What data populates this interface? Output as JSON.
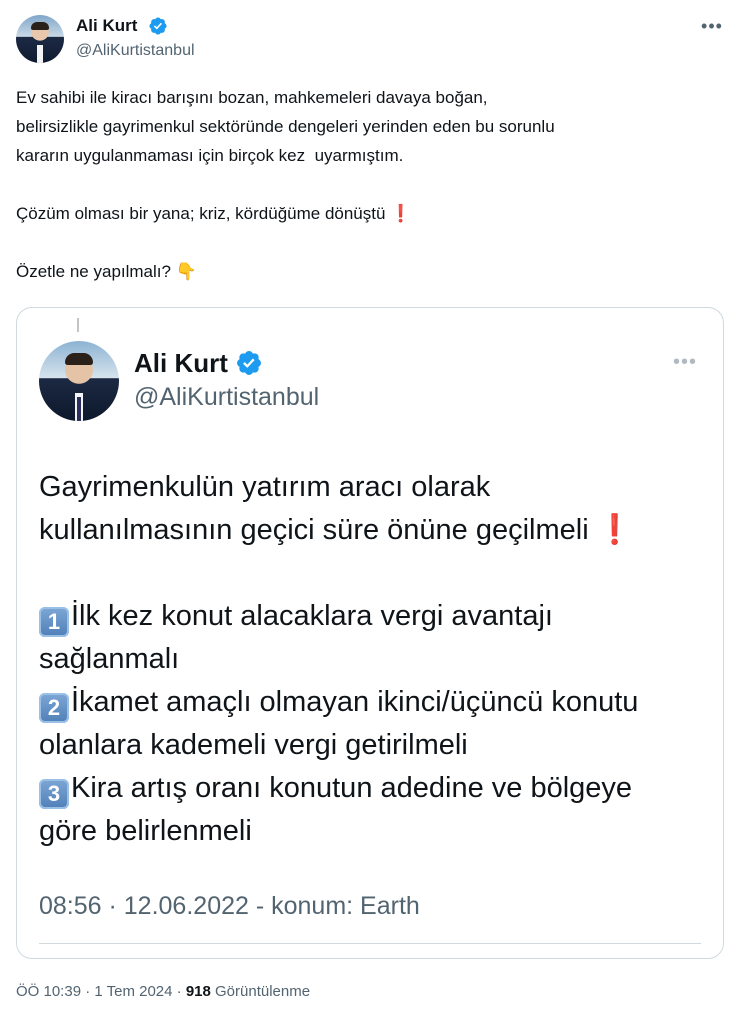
{
  "author": {
    "name": "Ali Kurt",
    "handle": "@AliKurtistanbul",
    "verified_icon": "verified-badge-icon",
    "more_icon": "more-options-icon"
  },
  "tweet": {
    "line1": "Ev sahibi ile kiracı barışını bozan, mahkemeleri davaya boğan,",
    "line2": "belirsizlikle gayrimenkul sektöründe dengeleri yerinden eden bu sorunlu",
    "line3": "kararın uygulanmaması için birçok kez  uyarmıştım.",
    "line4": "Çözüm olması bir yana; kriz, kördüğüme dönüştü",
    "line4_emoji": "❗",
    "line5": "Özetle ne yapılmalı?",
    "line5_emoji": "👇"
  },
  "quoted": {
    "name": "Ali Kurt",
    "handle": "@AliKurtistanbul",
    "intro_line1": "Gayrimenkulün yatırım aracı olarak",
    "intro_line2": "kullanılmasının geçici süre önüne geçilmeli",
    "intro_emoji": "❗",
    "items": [
      {
        "number": "1",
        "line1": "İlk kez konut alacaklara vergi avantajı",
        "line2": "sağlanmalı"
      },
      {
        "number": "2",
        "line1": "İkamet amaçlı olmayan ikinci/üçüncü konutu",
        "line2": "olanlara kademeli vergi getirilmeli"
      },
      {
        "number": "3",
        "line1": "Kira artış oranı konutun adedine ve bölgeye",
        "line2": "göre belirlenmeli"
      }
    ],
    "meta": "08:56 · 12.06.2022 - konum: Earth"
  },
  "footer": {
    "time": "ÖÖ 10:39 · 1 Tem 2024 · ",
    "views_count": "918",
    "views_label": " Görüntülenme"
  },
  "colors": {
    "verified": "#1d9bf0",
    "secondary_text": "#536471",
    "primary_text": "#0f1419",
    "border": "#cfd9de"
  }
}
